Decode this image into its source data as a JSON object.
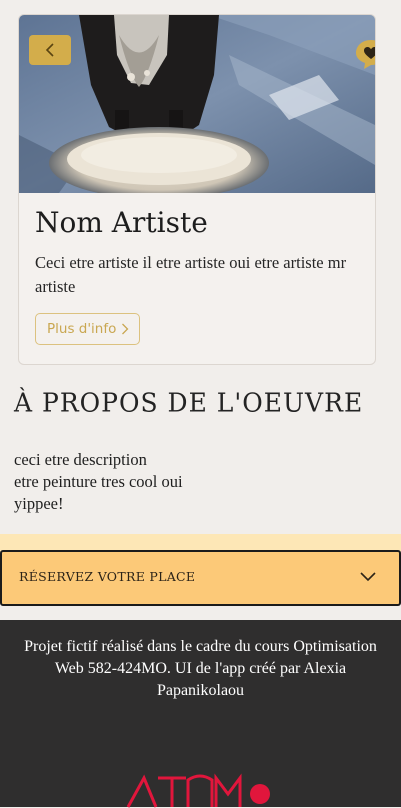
{
  "artist_card": {
    "name": "Nom Artiste",
    "bio": "Ceci etre artiste il etre artiste oui etre artiste mr artiste",
    "more_button_label": "Plus d'info",
    "back_icon": "chevron-left-icon",
    "favorite_icon": "heart-bubble-icon"
  },
  "about": {
    "title": "À PROPOS DE L'OEUVRE",
    "description_lines": [
      "ceci etre description",
      "etre peinture tres cool oui",
      "yippee!"
    ]
  },
  "reservation": {
    "label": "RÉSERVEZ VOTRE PLACE",
    "icon": "chevron-down-icon"
  },
  "footer": {
    "text": "Projet fictif réalisé dans le cadre du cours Optimisation Web 582-424MO. UI de l'app créé par Alexia Papanikolaou",
    "logo": "logo"
  },
  "colors": {
    "page_background": "#f1eeeb",
    "accent_gold": "#d3ad4b",
    "reservation_bar": "#fcc978",
    "reservation_band": "#fde7b6",
    "footer_background": "#2f2e2e",
    "logo_red": "#e1163c"
  }
}
